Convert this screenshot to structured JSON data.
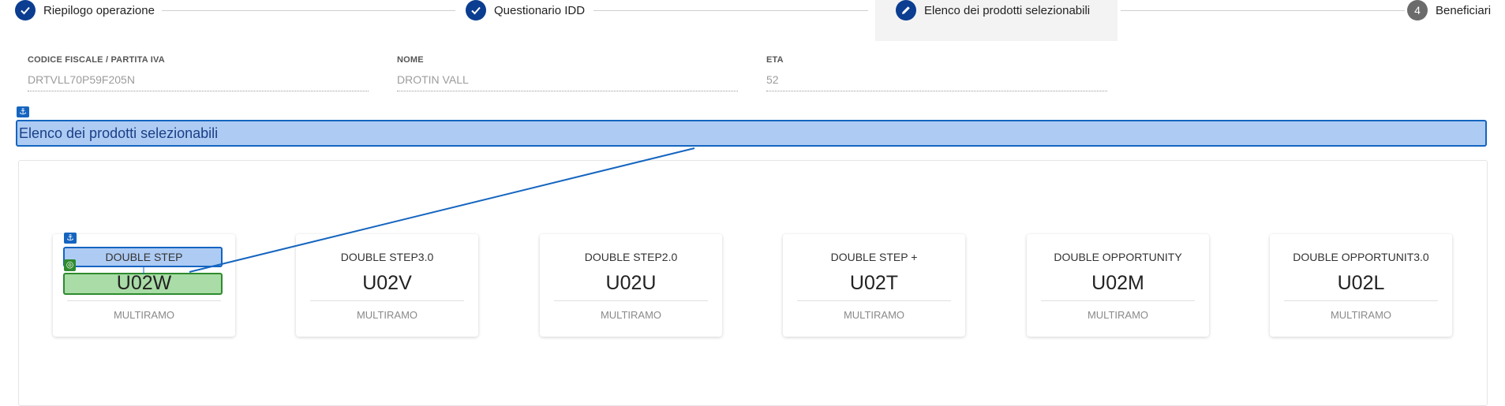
{
  "stepper": {
    "steps": [
      {
        "label": "Riepilogo operazione",
        "state": "done",
        "icon": "check-icon"
      },
      {
        "label": "Questionario IDD",
        "state": "done",
        "icon": "check-icon"
      },
      {
        "label": "Elenco dei prodotti selezionabili",
        "state": "active",
        "icon": "pencil-icon"
      },
      {
        "label": "Beneficiari",
        "state": "todo",
        "number": "4"
      }
    ]
  },
  "customer": {
    "codice_fiscale": {
      "label": "CODICE FISCALE / PARTITA IVA",
      "value": "DRTVLL70P59F205N"
    },
    "nome": {
      "label": "NOME",
      "value": "DROTIN VALL"
    },
    "eta": {
      "label": "ETA",
      "value": "52"
    }
  },
  "section": {
    "title": "Elenco dei prodotti selezionabili"
  },
  "products": [
    {
      "name": "DOUBLE STEP",
      "code": "U02W",
      "type": "MULTIRAMO"
    },
    {
      "name": "DOUBLE STEP3.0",
      "code": "U02V",
      "type": "MULTIRAMO"
    },
    {
      "name": "DOUBLE STEP2.0",
      "code": "U02U",
      "type": "MULTIRAMO"
    },
    {
      "name": "DOUBLE STEP +",
      "code": "U02T",
      "type": "MULTIRAMO"
    },
    {
      "name": "DOUBLE OPPORTUNITY",
      "code": "U02M",
      "type": "MULTIRAMO"
    },
    {
      "name": "DOUBLE OPPORTUNIT3.0",
      "code": "U02L",
      "type": "MULTIRAMO"
    }
  ],
  "colors": {
    "primary": "#0b3d91",
    "step_todo": "#6b6b6b",
    "highlight_blue": "#aecbf3",
    "highlight_blue_border": "#1565c0",
    "highlight_green": "#a9dca6",
    "highlight_green_border": "#2e8b2e"
  }
}
